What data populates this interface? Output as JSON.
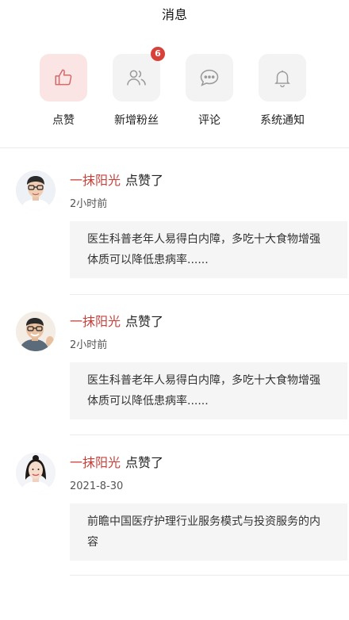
{
  "header": {
    "title": "消息"
  },
  "categories": [
    {
      "label": "点赞",
      "icon": "thumbs-up-icon",
      "active": true
    },
    {
      "label": "新增粉丝",
      "icon": "users-icon",
      "badge": "6"
    },
    {
      "label": "评论",
      "icon": "chat-bubble-icon"
    },
    {
      "label": "系统通知",
      "icon": "bell-icon"
    }
  ],
  "notifications": [
    {
      "user": "一抹阳光",
      "action": "点赞了",
      "time": "2小时前",
      "content": "医生科普老年人易得白内障，多吃十大食物增强体质可以降低患病率......"
    },
    {
      "user": "一抹阳光",
      "action": "点赞了",
      "time": "2小时前",
      "content": "医生科普老年人易得白内障，多吃十大食物增强体质可以降低患病率......"
    },
    {
      "user": "一抹阳光",
      "action": "点赞了",
      "time": "2021-8-30",
      "content": "前瞻中国医疗护理行业服务模式与投资服务的内容"
    }
  ],
  "colors": {
    "accent": "#c9413b",
    "badge": "#d7413a",
    "active_bg": "#fbe4e4",
    "tile_bg": "#f3f3f3"
  }
}
